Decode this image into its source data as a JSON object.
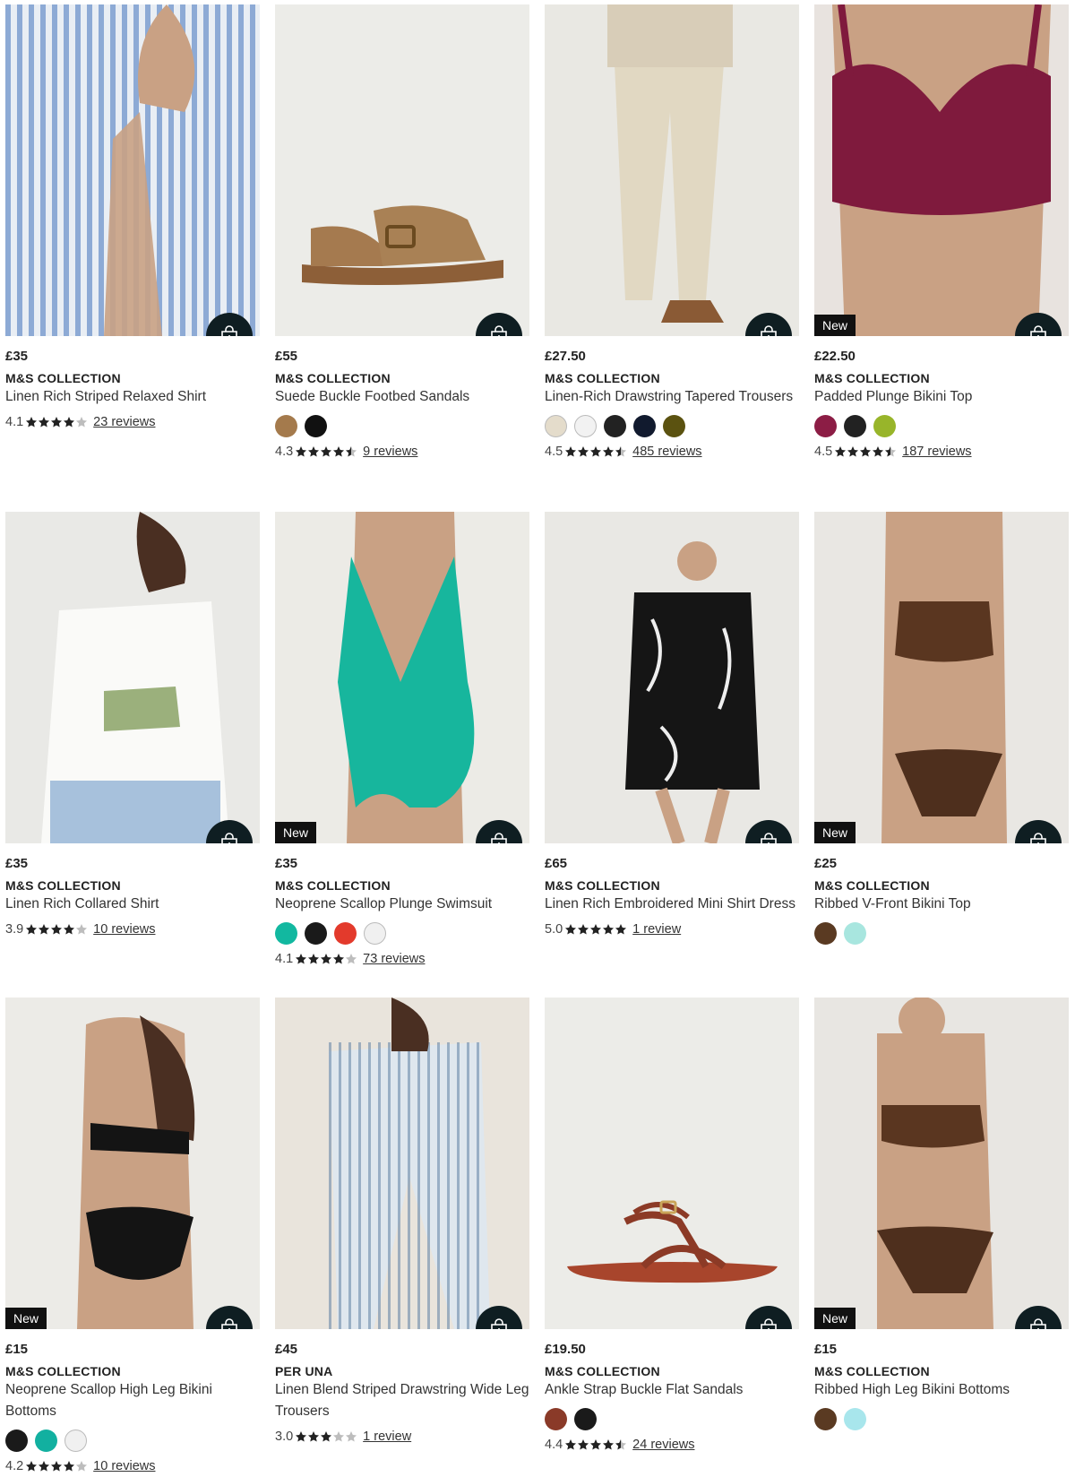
{
  "products": [
    {
      "price": "£35",
      "brand": "M&S COLLECTION",
      "name": "Linen Rich Striped Relaxed Shirt",
      "badge": "",
      "rating": "4.1",
      "rating_value": 4.1,
      "reviews": "23 reviews",
      "swatches": [],
      "image": {
        "kind": "striped-shirt",
        "bg": "#e9eef4"
      }
    },
    {
      "price": "£55",
      "brand": "M&S COLLECTION",
      "name": "Suede Buckle Footbed Sandals",
      "badge": "",
      "rating": "4.3",
      "rating_value": 4.3,
      "reviews": "9 reviews",
      "swatches": [
        "#a47a4c",
        "#111111"
      ],
      "image": {
        "kind": "sandal-tan",
        "bg": "#ecece8"
      }
    },
    {
      "price": "£27.50",
      "brand": "M&S COLLECTION",
      "name": "Linen-Rich Drawstring Tapered Trousers",
      "badge": "",
      "rating": "4.5",
      "rating_value": 4.5,
      "reviews": "485 reviews",
      "swatches": [
        "#e4dccb",
        "#f2f2f2",
        "#222222",
        "#111a2e",
        "#5b5210"
      ],
      "image": {
        "kind": "trousers",
        "bg": "#e9e8e3"
      }
    },
    {
      "price": "£22.50",
      "brand": "M&S COLLECTION",
      "name": "Padded Plunge Bikini Top",
      "badge": "New",
      "rating": "4.5",
      "rating_value": 4.5,
      "reviews": "187 reviews",
      "swatches": [
        "#8c1d45",
        "#222222",
        "#98b52a"
      ],
      "image": {
        "kind": "bikini-berry",
        "bg": "#e8e3df"
      }
    },
    {
      "price": "£35",
      "brand": "M&S COLLECTION",
      "name": "Linen Rich Collared Shirt",
      "badge": "",
      "rating": "3.9",
      "rating_value": 3.9,
      "reviews": "10 reviews",
      "swatches": [],
      "image": {
        "kind": "white-shirt",
        "bg": "#e9e9e6"
      }
    },
    {
      "price": "£35",
      "brand": "M&S COLLECTION",
      "name": "Neoprene Scallop Plunge Swimsuit",
      "badge": "New",
      "rating": "4.1",
      "rating_value": 4.1,
      "reviews": "73 reviews",
      "swatches": [
        "#12b8a0",
        "#1a1a1a",
        "#e33a2c",
        "#f0f0f0"
      ],
      "image": {
        "kind": "swimsuit",
        "bg": "#ecebe6"
      }
    },
    {
      "price": "£65",
      "brand": "M&S COLLECTION",
      "name": "Linen Rich Embroidered Mini Shirt Dress",
      "badge": "",
      "rating": "5.0",
      "rating_value": 5.0,
      "reviews": "1 review",
      "swatches": [],
      "image": {
        "kind": "shirt-dress",
        "bg": "#e9e8e4"
      }
    },
    {
      "price": "£25",
      "brand": "M&S COLLECTION",
      "name": "Ribbed V-Front Bikini Top",
      "badge": "New",
      "rating": "",
      "rating_value": 0,
      "reviews": "",
      "swatches": [
        "#5a3a22",
        "#a8e6df"
      ],
      "image": {
        "kind": "bikini-brown",
        "bg": "#e9e7e3"
      }
    },
    {
      "price": "£15",
      "brand": "M&S COLLECTION",
      "name": "Neoprene Scallop High Leg Bikini Bottoms",
      "badge": "New",
      "rating": "4.2",
      "rating_value": 4.2,
      "reviews": "10 reviews",
      "swatches": [
        "#1a1a1a",
        "#12b0a0",
        "#f0f0f0"
      ],
      "image": {
        "kind": "bikini-black",
        "bg": "#ecebe7"
      }
    },
    {
      "price": "£45",
      "brand": "PER UNA",
      "name": "Linen Blend Striped Drawstring Wide Leg Trousers",
      "badge": "",
      "rating": "3.0",
      "rating_value": 3.0,
      "reviews": "1 review",
      "swatches": [],
      "image": {
        "kind": "striped-set",
        "bg": "#e9e4dc"
      }
    },
    {
      "price": "£19.50",
      "brand": "M&S COLLECTION",
      "name": "Ankle Strap Buckle Flat Sandals",
      "badge": "",
      "rating": "4.4",
      "rating_value": 4.4,
      "reviews": "24 reviews",
      "swatches": [
        "#8a3a28",
        "#1a1a1a"
      ],
      "image": {
        "kind": "sandal-red",
        "bg": "#ecece8"
      }
    },
    {
      "price": "£15",
      "brand": "M&S COLLECTION",
      "name": "Ribbed High Leg Bikini Bottoms",
      "badge": "New",
      "rating": "",
      "rating_value": 0,
      "reviews": "",
      "swatches": [
        "#5a3a22",
        "#a8e6ec"
      ],
      "image": {
        "kind": "bikini-brown2",
        "bg": "#e8e6e2"
      }
    }
  ],
  "icons": {
    "add_to_bag": "bag-plus-icon",
    "star": "star-icon"
  },
  "colors": {
    "bag_button": "#0f1e22",
    "badge": "#111111",
    "star": "#222222"
  }
}
